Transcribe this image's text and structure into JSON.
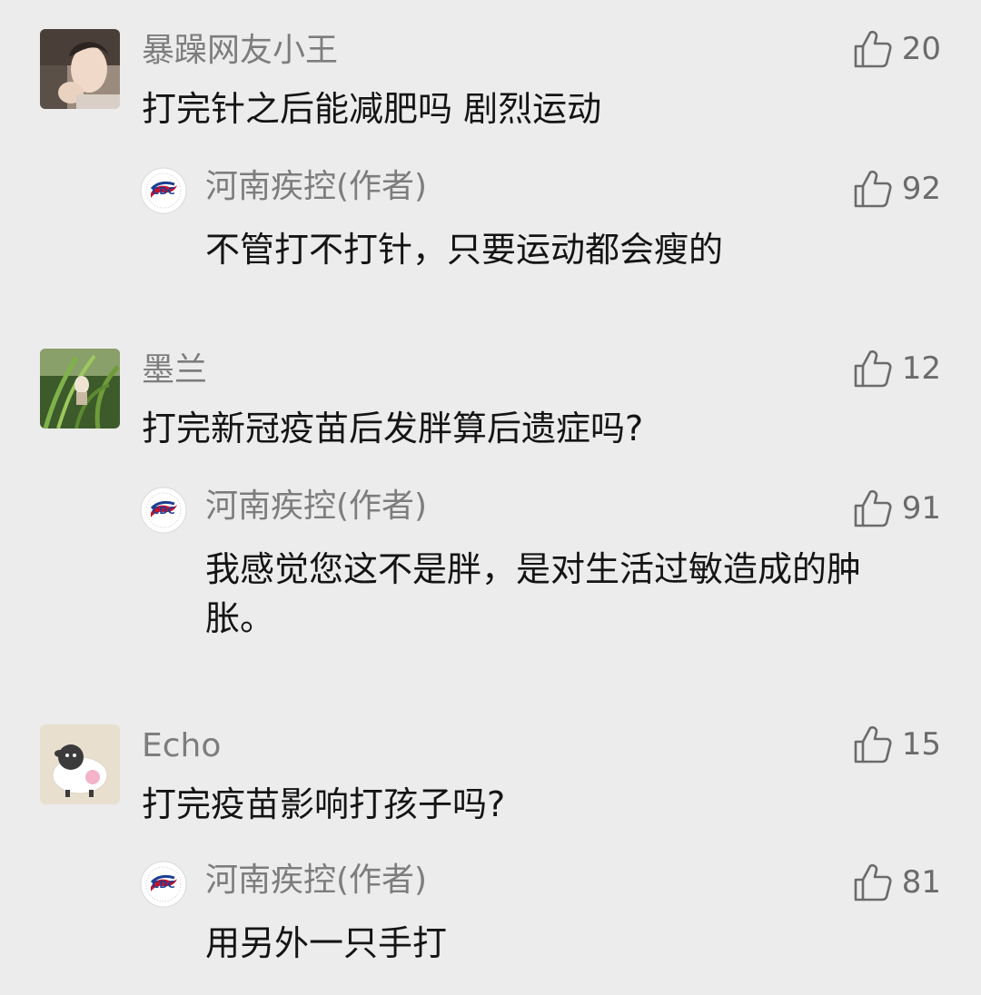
{
  "threads": [
    {
      "comment": {
        "author": "暴躁网友小王",
        "text": "打完针之后能减肥吗 剧烈运动",
        "likes": "20",
        "avatar": "person-photo-avatar"
      },
      "reply": {
        "author": "河南疾控(作者)",
        "text": "不管打不打针，只要运动都会瘦的",
        "likes": "92",
        "avatar": "cdc-logo-avatar"
      }
    },
    {
      "comment": {
        "author": "墨兰",
        "text": "打完新冠疫苗后发胖算后遗症吗?",
        "likes": "12",
        "avatar": "plant-photo-avatar"
      },
      "reply": {
        "author": "河南疾控(作者)",
        "text": "我感觉您这不是胖，是对生活过敏造成的肿胀。",
        "likes": "91",
        "avatar": "cdc-logo-avatar"
      }
    },
    {
      "comment": {
        "author": "Echo",
        "text": "打完疫苗影响打孩子吗?",
        "likes": "15",
        "avatar": "sheep-cartoon-avatar"
      },
      "reply": {
        "author": "河南疾控(作者)",
        "text": "用另外一只手打",
        "likes": "81",
        "avatar": "cdc-logo-avatar"
      }
    }
  ],
  "icons": {
    "like": "thumbs-up-icon"
  },
  "colors": {
    "background": "#ececec",
    "name": "#7d7d7d",
    "text": "#141414",
    "like": "#6b6b6b"
  }
}
